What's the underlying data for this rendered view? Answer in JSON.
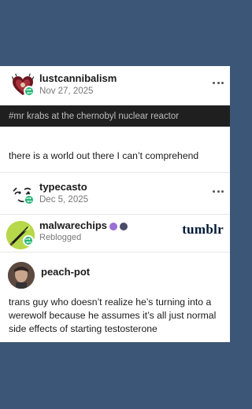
{
  "posts": [
    {
      "username": "lustcannibalism",
      "date": "Nov 27, 2025",
      "tag": "#mr krabs at the chernobyl nuclear reactor",
      "text": "there is a world out there I can’t comprehend"
    },
    {
      "username": "typecasto",
      "date": "Dec 5, 2025"
    },
    {
      "username": "malwarechips",
      "status": "Reblogged",
      "brand": "tumblr"
    },
    {
      "username": "peach-pot",
      "text": "trans guy who doesn’t realize he’s turning into a werewolf because he assumes it’s all just normal side effects of starting testosterone"
    }
  ],
  "icons": {
    "more": "more-options-icon",
    "reblog_badge": "reblog-icon"
  },
  "colors": {
    "background": "#3b5677",
    "badge": "#22b573",
    "tag_bar": "#1f1f1f",
    "brand": "#001935"
  }
}
